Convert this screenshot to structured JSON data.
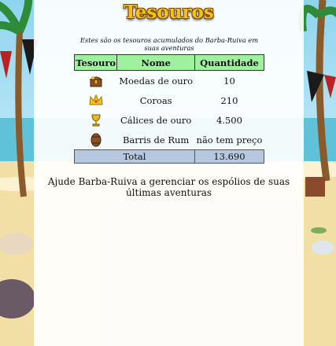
{
  "page": {
    "title": "Tesouros",
    "intro": "Estes são os tesouros acumulados do Barba-Ruiva em suas aventuras",
    "outro": "Ajude Barba-Ruiva a gerenciar os espólios de suas últimas aventuras"
  },
  "table": {
    "headers": [
      "Tesouro",
      "Nome",
      "Quantidade"
    ],
    "rows": [
      {
        "icon": "treasure-chest-icon",
        "name": "Moedas de ouro",
        "quantity": "10"
      },
      {
        "icon": "crown-icon",
        "name": "Coroas",
        "quantity": "210"
      },
      {
        "icon": "chalice-icon",
        "name": "Cálices de ouro",
        "quantity": "4.500"
      },
      {
        "icon": "rum-barrel-icon",
        "name": "Barris de Rum",
        "quantity": "não tem preço"
      }
    ],
    "total_label": "Total",
    "total_value": "13.690"
  },
  "colors": {
    "title": "#f6c21a",
    "header_bg": "#9ff1a0",
    "total_bg": "#b5c8e0"
  }
}
